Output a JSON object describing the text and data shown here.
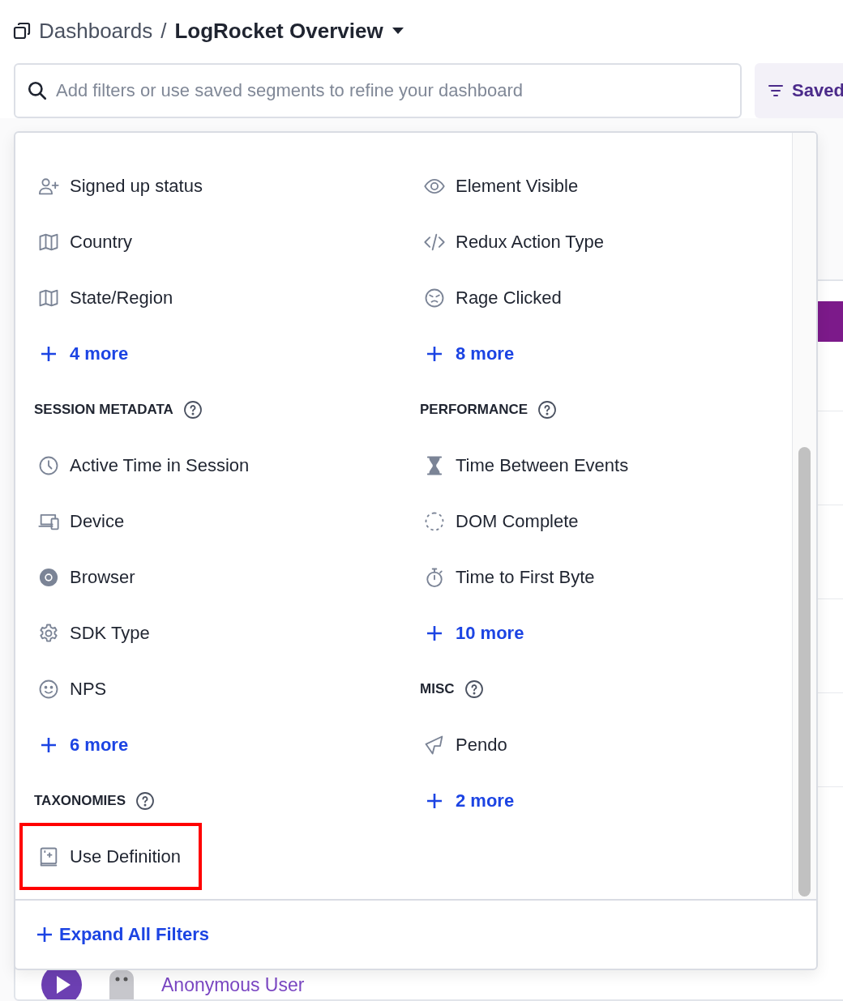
{
  "breadcrumb": {
    "parent": "Dashboards",
    "separator": "/",
    "current": "LogRocket Overview"
  },
  "search": {
    "placeholder": "Add filters or use saved segments to refine your dashboard"
  },
  "saved_button": {
    "label": "Saved"
  },
  "filter_menu": {
    "columns": [
      [
        {
          "kind": "item",
          "label": "Signed up status",
          "highlighted": false
        },
        {
          "kind": "item",
          "label": "Country",
          "highlighted": false
        },
        {
          "kind": "item",
          "label": "State/Region",
          "highlighted": false
        },
        {
          "kind": "more",
          "label": "4 more"
        },
        {
          "kind": "heading",
          "label": "SESSION METADATA"
        },
        {
          "kind": "item",
          "label": "Active Time in Session",
          "highlighted": false
        },
        {
          "kind": "item",
          "label": "Device",
          "highlighted": false
        },
        {
          "kind": "item",
          "label": "Browser",
          "highlighted": false
        },
        {
          "kind": "item",
          "label": "SDK Type",
          "highlighted": false
        },
        {
          "kind": "item",
          "label": "NPS",
          "highlighted": false
        },
        {
          "kind": "more",
          "label": "6 more"
        },
        {
          "kind": "heading",
          "label": "TAXONOMIES"
        },
        {
          "kind": "item",
          "label": "Use Definition",
          "highlighted": true
        }
      ],
      [
        {
          "kind": "item",
          "label": "Element Visible",
          "highlighted": false
        },
        {
          "kind": "item",
          "label": "Redux Action Type",
          "highlighted": false
        },
        {
          "kind": "item",
          "label": "Rage Clicked",
          "highlighted": false
        },
        {
          "kind": "more",
          "label": "8 more"
        },
        {
          "kind": "heading",
          "label": "PERFORMANCE"
        },
        {
          "kind": "item",
          "label": "Time Between Events",
          "highlighted": false
        },
        {
          "kind": "item",
          "label": "DOM Complete",
          "highlighted": false
        },
        {
          "kind": "item",
          "label": "Time to First Byte",
          "highlighted": false
        },
        {
          "kind": "more",
          "label": "10 more"
        },
        {
          "kind": "heading",
          "label": "MISC"
        },
        {
          "kind": "item",
          "label": "Pendo",
          "highlighted": false
        },
        {
          "kind": "more",
          "label": "2 more"
        }
      ]
    ],
    "expand_all": "Expand All Filters"
  },
  "session_row": {
    "user": "Anonymous User"
  }
}
